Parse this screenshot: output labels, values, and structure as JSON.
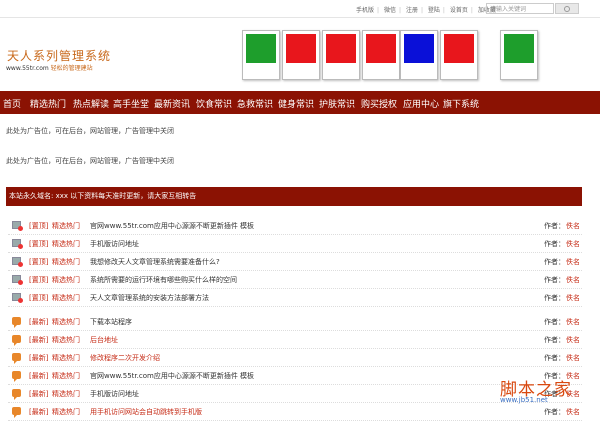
{
  "top_links": [
    "手机版",
    "微信",
    "注册",
    "登陆",
    "设首页",
    "加收藏"
  ],
  "search": {
    "placeholder": "请输入关键词"
  },
  "logo": {
    "title": "天人系列管理系统",
    "url": "www.55tr.com",
    "slogan": "轻松的管理建站"
  },
  "banner": {
    "colors": [
      "#1e9e2c",
      "#e8161c",
      "#e8161c",
      "#e8161c",
      "#0a10d8",
      "#e8161c",
      "#1e9e2c"
    ]
  },
  "nav": [
    "首页",
    "精选热门",
    "热点解读",
    "高手坐堂",
    "最新资讯",
    "饮食常识",
    "急救常识",
    "健身常识",
    "护肤常识",
    "购买授权",
    "应用中心",
    "旗下系统"
  ],
  "ads": [
    "此处为广告位，可在后台，网站管理，广告管理中关闭",
    "此处为广告位，可在后台，网站管理，广告管理中关闭"
  ],
  "notice": "本站永久域名: xxx 以下资料每天准时更新，请大家互相转告",
  "author_label": "作者：",
  "posts": [
    {
      "tag": "[置顶]",
      "category": "精选热门",
      "title": "官网www.55tr.com应用中心源源不断更新插件 模板",
      "author": "佚名",
      "icon": "doc-icon",
      "red": false
    },
    {
      "tag": "[置顶]",
      "category": "精选热门",
      "title": "手机版访问地址",
      "author": "佚名",
      "icon": "doc-icon",
      "red": false
    },
    {
      "tag": "[置顶]",
      "category": "精选热门",
      "title": "我想修改天人文章管理系统需要准备什么?",
      "author": "佚名",
      "icon": "doc-icon",
      "red": false
    },
    {
      "tag": "[置顶]",
      "category": "精选热门",
      "title": "系统所需要的运行环境有哪些购买什么样的空间",
      "author": "佚名",
      "icon": "doc-icon",
      "red": false
    },
    {
      "tag": "[置顶]",
      "category": "精选热门",
      "title": "天人文章管理系统的安装方法部署方法",
      "author": "佚名",
      "icon": "doc-icon",
      "red": false
    },
    {
      "tag": "[最新]",
      "category": "精选热门",
      "title": "下载本站程序",
      "author": "佚名",
      "icon": "bubble-icon",
      "red": false
    },
    {
      "tag": "[最新]",
      "category": "精选热门",
      "title": "后台地址",
      "author": "佚名",
      "icon": "bubble-icon",
      "red": true
    },
    {
      "tag": "[最新]",
      "category": "精选热门",
      "title": "修改程序二次开发介绍",
      "author": "佚名",
      "icon": "bubble-icon",
      "red": true
    },
    {
      "tag": "[最新]",
      "category": "精选热门",
      "title": "官网www.55tr.com应用中心源源不断更新插件 模板",
      "author": "佚名",
      "icon": "bubble-icon",
      "red": false
    },
    {
      "tag": "[最新]",
      "category": "精选热门",
      "title": "手机版访问地址",
      "author": "佚名",
      "icon": "bubble-icon",
      "red": false
    },
    {
      "tag": "[最新]",
      "category": "精选热门",
      "title": "用手机访问网站会自动跳转到手机版",
      "author": "佚名",
      "icon": "bubble-icon",
      "red": true
    }
  ],
  "watermark": {
    "title": "脚本之家",
    "url": "www.jb51.net"
  }
}
